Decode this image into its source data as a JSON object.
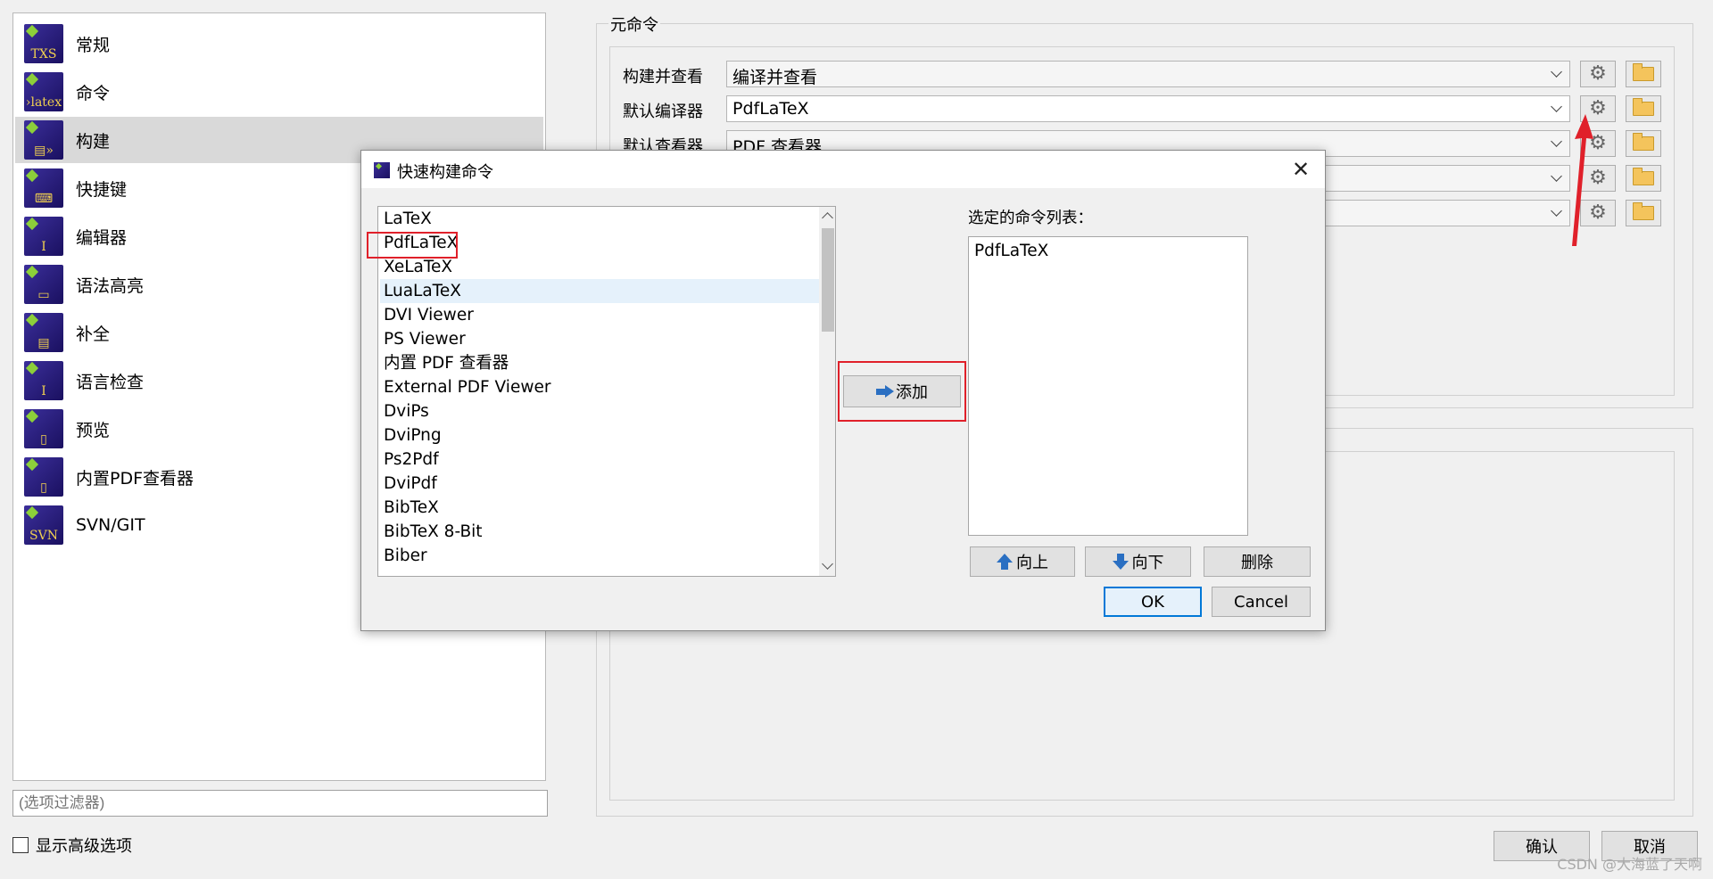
{
  "nav": {
    "items": [
      {
        "label": "常规",
        "icon": "txs-icon",
        "glyph": "TXS"
      },
      {
        "label": "命令",
        "icon": "latex-icon",
        "glyph": "›latex"
      },
      {
        "label": "构建",
        "icon": "build-icon",
        "glyph": "▤»"
      },
      {
        "label": "快捷键",
        "icon": "keyboard-icon",
        "glyph": "⌨"
      },
      {
        "label": "编辑器",
        "icon": "editor-icon",
        "glyph": "I"
      },
      {
        "label": "语法高亮",
        "icon": "highlight-icon",
        "glyph": "▭"
      },
      {
        "label": "补全",
        "icon": "completion-icon",
        "glyph": "▤"
      },
      {
        "label": "语言检查",
        "icon": "spellcheck-icon",
        "glyph": "I"
      },
      {
        "label": "预览",
        "icon": "preview-icon",
        "glyph": "▯"
      },
      {
        "label": "内置PDF查看器",
        "icon": "pdf-viewer-icon",
        "glyph": "▯"
      },
      {
        "label": "SVN/GIT",
        "icon": "svn-icon",
        "glyph": "SVN"
      }
    ],
    "selected_index": 2
  },
  "filter": {
    "placeholder": "(选项过滤器)"
  },
  "advanced": {
    "label": "显示高级选项",
    "checked": false
  },
  "meta": {
    "legend": "元命令",
    "rows": [
      {
        "label": "构建并查看",
        "value": "编译并查看"
      },
      {
        "label": "默认编译器",
        "value": "PdfLaTeX"
      },
      {
        "label": "默认查看器",
        "value": "PDF 查看器"
      }
    ]
  },
  "footer": {
    "ok_label": "确认",
    "cancel_label": "取消"
  },
  "dialog": {
    "title": "快速构建命令",
    "close_glyph": "✕",
    "commands": [
      "LaTeX",
      "PdfLaTeX",
      "XeLaTeX",
      "LuaLaTeX",
      "DVI Viewer",
      "PS Viewer",
      "内置 PDF 查看器",
      "External PDF Viewer",
      "DviPs",
      "DviPng",
      "Ps2Pdf",
      "DviPdf",
      "BibTeX",
      "BibTeX 8-Bit",
      "Biber"
    ],
    "hovered_index": 3,
    "add_label": "添加",
    "selected_label": "选定的命令列表：",
    "selected_commands": [
      "PdfLaTeX"
    ],
    "up_label": "向上",
    "down_label": "向下",
    "delete_label": "删除",
    "ok_label": "OK",
    "cancel_label": "Cancel"
  },
  "colors": {
    "highlight": "#e0202a",
    "accent": "#0078d7"
  },
  "watermark": "CSDN @大海蓝了天啊"
}
